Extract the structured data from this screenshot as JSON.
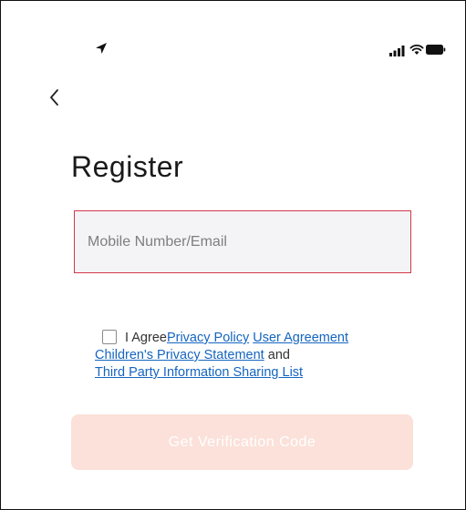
{
  "status_bar": {
    "icons": [
      "location-arrow-icon",
      "cellular-signal-icon",
      "wifi-icon",
      "battery-icon"
    ]
  },
  "navigation": {
    "back_glyph": "‹",
    "back_icon": "chevron-left-icon"
  },
  "page": {
    "title": "Register"
  },
  "form": {
    "account_input": {
      "value": "",
      "placeholder": "Mobile Number/Email",
      "border_color": "#d2374a"
    }
  },
  "agreement": {
    "checked": false,
    "prefix": "I Agree",
    "privacy_policy": "Privacy Policy",
    "user_agreement": "User Agreement",
    "childrens_privacy": "Children's Privacy Statement",
    "and": "and",
    "third_party_list": "Third Party Information Sharing List",
    "link_color": "#1565c0"
  },
  "actions": {
    "get_code_label": "Get Verification Code",
    "get_code_enabled": false,
    "button_color": "#fbe1da"
  }
}
